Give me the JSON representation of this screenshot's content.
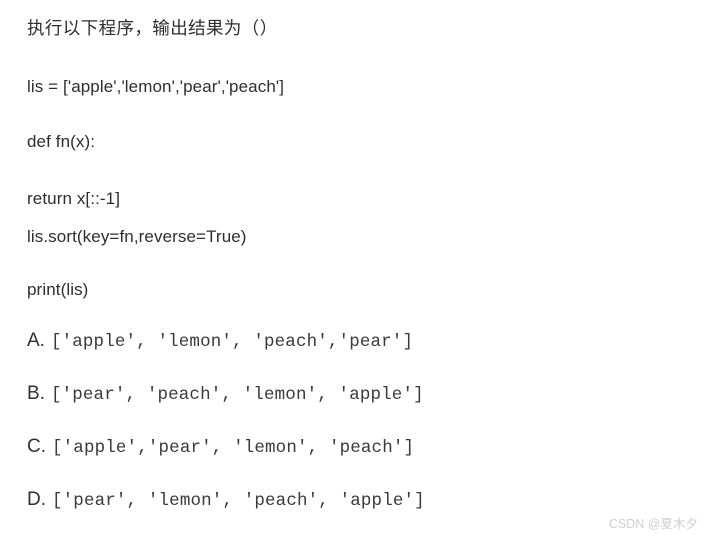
{
  "page": {
    "background_color": "#ffffff",
    "text_color": "#2e2e2e"
  },
  "question": {
    "prompt": "执行以下程序，输出结果为（）",
    "code_lines": [
      "lis = ['apple','lemon','pear','peach']",
      "def fn(x):",
      "return x[::-1]",
      "lis.sort(key=fn,reverse=True)",
      "print(lis)"
    ]
  },
  "options": [
    {
      "letter": "A.",
      "text": "['apple', 'lemon', 'peach','pear']"
    },
    {
      "letter": "B.",
      "text": "['pear', 'peach', 'lemon', 'apple']"
    },
    {
      "letter": "C.",
      "text": "['apple','pear', 'lemon', 'peach']"
    },
    {
      "letter": "D.",
      "text": "['pear', 'lemon', 'peach', 'apple']"
    }
  ],
  "watermark": {
    "text": "CSDN @夏木夕",
    "color": "#cfcfcf"
  }
}
